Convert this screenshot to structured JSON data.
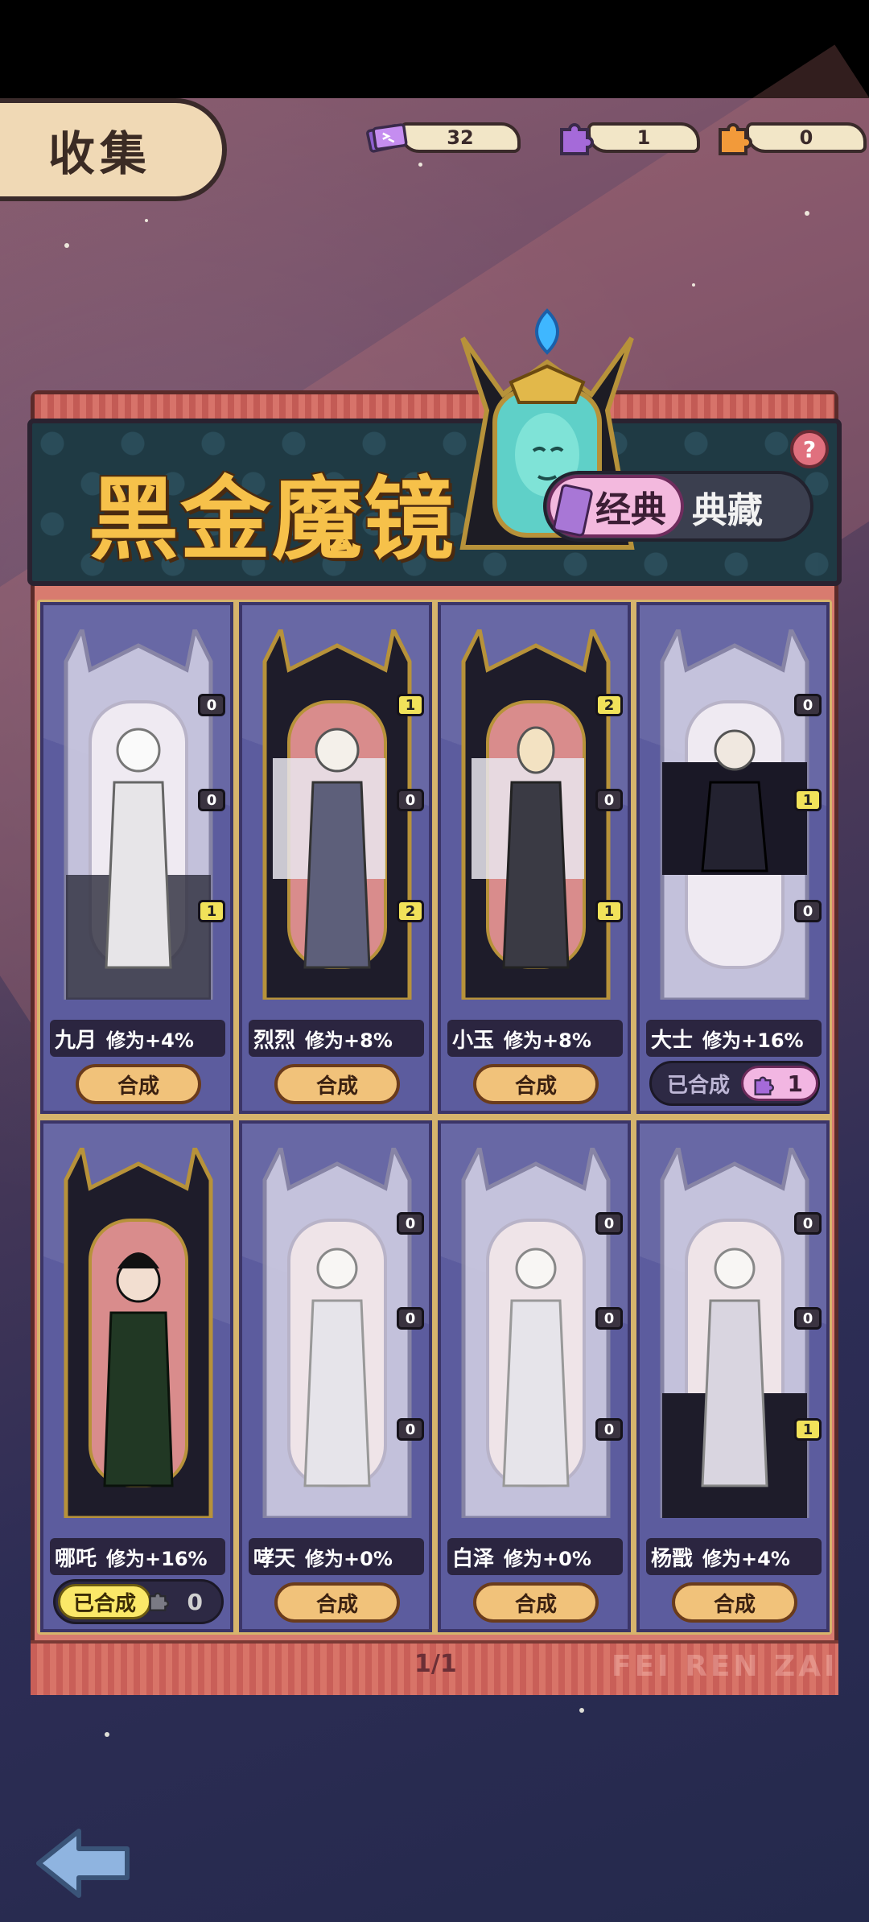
{
  "screen": {
    "title": "收集"
  },
  "currencies": [
    {
      "icon": "ticket-icon",
      "value": "32",
      "color": "#b87ce6"
    },
    {
      "icon": "purple-puzzle-icon",
      "value": "1",
      "color": "#a56ad9"
    },
    {
      "icon": "orange-puzzle-icon",
      "value": "0",
      "color": "#f29a3a"
    }
  ],
  "collection": {
    "title": "黑金魔镜",
    "help": "?",
    "tabs": [
      {
        "label": "经典",
        "active": true
      },
      {
        "label": "典藏",
        "active": false
      }
    ]
  },
  "cards": [
    {
      "name": "九月",
      "bonus": "修为+4%",
      "pieces": [
        "0",
        "0",
        "1"
      ],
      "action": "合成"
    },
    {
      "name": "烈烈",
      "bonus": "修为+8%",
      "pieces": [
        "1",
        "0",
        "2"
      ],
      "action": "合成"
    },
    {
      "name": "小玉",
      "bonus": "修为+8%",
      "pieces": [
        "2",
        "0",
        "1"
      ],
      "action": "合成"
    },
    {
      "name": "大士",
      "bonus": "修为+16%",
      "pieces": [
        "0",
        "1",
        "0"
      ],
      "status": "已合成",
      "count": "1"
    },
    {
      "name": "哪吒",
      "bonus": "修为+16%",
      "pieces": [],
      "status": "已合成",
      "count": "0"
    },
    {
      "name": "哮天",
      "bonus": "修为+0%",
      "pieces": [
        "0",
        "0",
        "0"
      ],
      "action": "合成"
    },
    {
      "name": "白泽",
      "bonus": "修为+0%",
      "pieces": [
        "0",
        "0",
        "0"
      ],
      "action": "合成"
    },
    {
      "name": "杨戬",
      "bonus": "修为+4%",
      "pieces": [
        "0",
        "0",
        "1"
      ],
      "action": "合成"
    }
  ],
  "pagination": {
    "label": "1/1"
  },
  "watermark": "FEI REN ZAI",
  "colors": {
    "accent_gold": "#f6c14a",
    "button": "#f1c27a",
    "card_bg": "#5c5c9e",
    "panel": "#d87b6f"
  }
}
